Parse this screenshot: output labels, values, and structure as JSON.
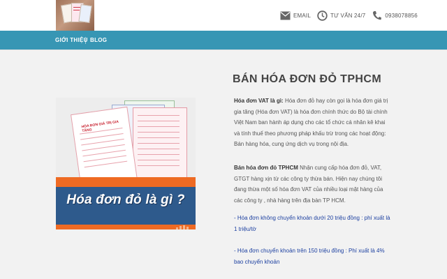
{
  "header": {
    "contacts": [
      {
        "icon": "email-icon",
        "label": "EMAIL"
      },
      {
        "icon": "clock-icon",
        "label": "TƯ VẤN 24/7"
      },
      {
        "icon": "phone-icon",
        "label": "0938078856"
      }
    ]
  },
  "nav": {
    "items": [
      "GIỚI THIỆU",
      "BLOG"
    ]
  },
  "hero": {
    "caption": "Hóa đơn đỏ là gì ?",
    "paper_title": "HÓA ĐƠN GIÁ TRỊ GIA TĂNG"
  },
  "article": {
    "title": "BÁN HÓA ĐƠN ĐỎ TPHCM",
    "p1_bold": "Hóa đơn VAT là gì:",
    "p1_text": " Hóa đơn đỏ hay còn gọi là hóa đơn giá trị gia tăng (Hóa đơn VAT) là hóa đơn chính thức do Bộ tài chính Việt Nam ban hành áp dụng cho các tổ chức cá nhân kê khai và tính thuế theo phương pháp khấu trừ trong các hoạt động: Bán hàng hóa, cung ứng dịch vụ trong nội địa.",
    "p2_bold": "Bán hóa đơn đỏ TPHCM",
    "p2_text": " Nhận cung cấp hóa đơn đỏ, VAT, GTGT hàng xịn từ các công ty thừa bán. Hiện nay chúng tôi đang thừa một số hóa đơn VAT của nhiều loại mặt hàng của các công ty , nhà hàng trên địa bàn TP HCM.",
    "p3": "- Hóa đơn không chuyển khoản dưới 20 triệu đồng : phí xuất là 1 triệu/tờ",
    "p4": "- Hóa đơn chuyển khoản trên 150 triệu đồng : Phí xuất là 4% bao chuyển khoản"
  },
  "colors": {
    "nav_bg": "#3796b4",
    "content_bg": "#f2f2f2",
    "link_blue": "#1b3fa0",
    "banner_orange": "#ee6a23"
  }
}
